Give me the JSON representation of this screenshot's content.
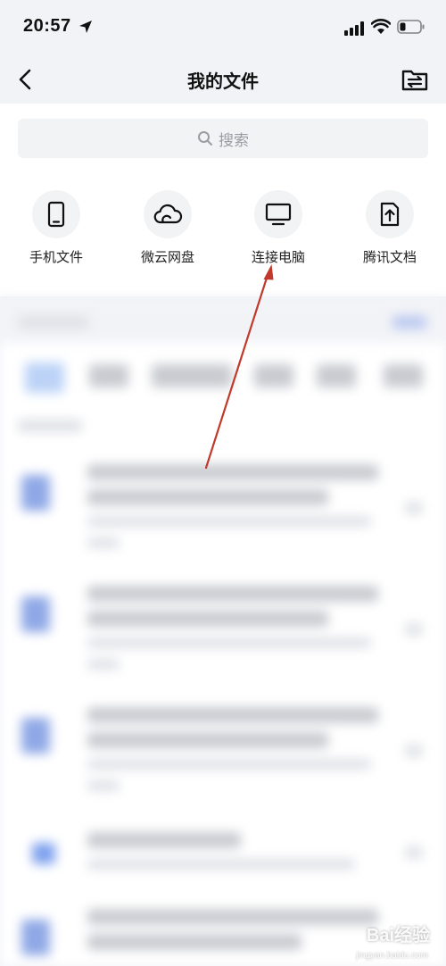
{
  "status_bar": {
    "time": "20:57",
    "icons": [
      "location-arrow-icon",
      "signal-icon",
      "wifi-icon",
      "battery-icon"
    ]
  },
  "nav": {
    "title": "我的文件",
    "back_icon": "chevron-left-icon",
    "right_icon": "folder-transfer-icon"
  },
  "search": {
    "placeholder": "搜索"
  },
  "quick_access": [
    {
      "label": "手机文件",
      "icon": "phone-icon"
    },
    {
      "label": "微云网盘",
      "icon": "cloud-icon"
    },
    {
      "label": "连接电脑",
      "icon": "monitor-icon"
    },
    {
      "label": "腾讯文档",
      "icon": "document-upload-icon"
    }
  ],
  "annotation": {
    "type": "arrow",
    "color": "#c0392b",
    "points_to": "连接电脑"
  },
  "watermark": {
    "text": "Bai经验",
    "sub": "jingyan.baidu.com"
  },
  "colors": {
    "background": "#f2f3f7",
    "card": "#ffffff",
    "icon_circle": "#f2f3f5",
    "placeholder": "#9b9ca3",
    "blurred_file_icon": "#8fa8e6"
  }
}
